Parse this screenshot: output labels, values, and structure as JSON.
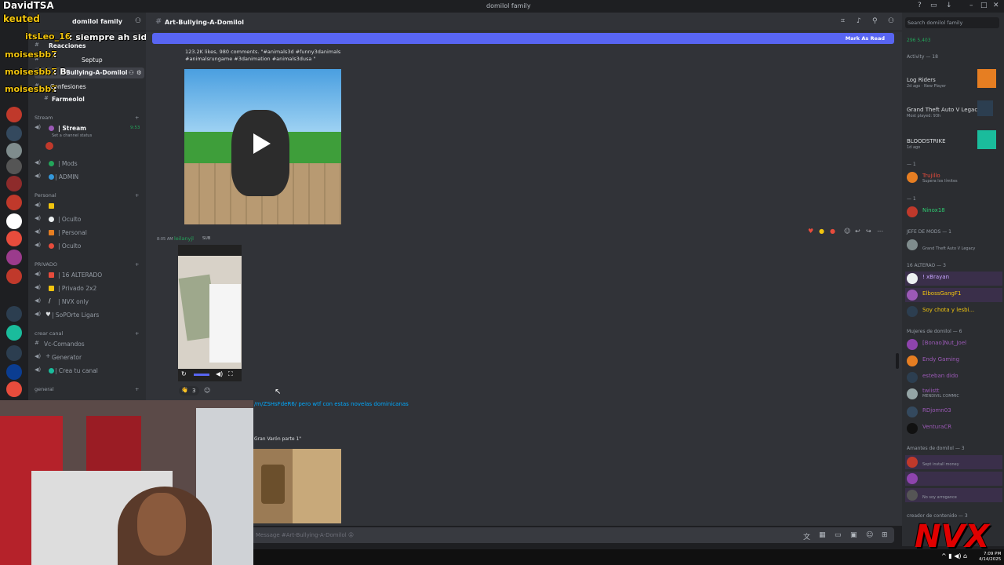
{
  "window": {
    "title": "domilol family",
    "icons": [
      "minimize-icon",
      "maximize-icon",
      "close-icon"
    ]
  },
  "server": {
    "name": "domilol family"
  },
  "overlay": {
    "streamer_tag": "DavidTSA",
    "lines": [
      {
        "user": "keuted",
        "text": ""
      },
      {
        "user": "itsLeo_16",
        "text": ": siempre ah sido w pero una de sus"
      },
      {
        "user": "moisesbb7",
        "text": ":"
      },
      {
        "user": "moisesbb7",
        "text": ": B"
      },
      {
        "user": "moisesbb7",
        "text": ":"
      }
    ]
  },
  "channels": {
    "top": [
      {
        "icon": "#",
        "label": "Reacciones"
      },
      {
        "icon": "#",
        "label": "Septup"
      },
      {
        "icon": "#",
        "label": "Bullying-A-Domilol"
      },
      {
        "icon": "#",
        "label": "Confesiones"
      },
      {
        "icon": "#",
        "label": "Farmeolol"
      }
    ],
    "categories": [
      {
        "label": "Stream",
        "items": [
          {
            "label": "| Stream",
            "sub": "Set a channel status",
            "count": "9:53"
          },
          {
            "label": "| Mods"
          },
          {
            "label": "| ADMIN"
          }
        ]
      },
      {
        "label": "Personal",
        "items": [
          {
            "label": ""
          },
          {
            "label": "| Oculto"
          },
          {
            "label": "| Personal"
          },
          {
            "label": "| Oculto"
          }
        ]
      },
      {
        "label": "PRIVADO",
        "items": [
          {
            "label": "| 16 ALTERADO"
          },
          {
            "label": "| Privado 2x2"
          },
          {
            "label": "| NVX only"
          },
          {
            "label": "| SoPOrte Ligars"
          }
        ]
      },
      {
        "label": "crear canal",
        "items": [
          {
            "label": "Vc-Comandos"
          },
          {
            "label": "Generator"
          },
          {
            "label": "| Crea tu canal"
          }
        ]
      },
      {
        "label": "general",
        "items": []
      }
    ]
  },
  "header": {
    "channel": "Art-Bullying-A-Domilol",
    "new_messages": "Mark As Read",
    "icons": [
      "threads-icon",
      "bell-icon",
      "pin-icon",
      "members-icon"
    ]
  },
  "messages": {
    "video1": {
      "caption": "123.2K likes, 980 comments. \"#animals3d #funny3danimals #animalsrungame #3danimation #animals3dusa \""
    },
    "msg2": {
      "time": "8:05 AM",
      "user": "leilanyjl",
      "tag": "SUB"
    },
    "reaction": {
      "emoji": "👋",
      "count": "3"
    },
    "link_text": "/m/ZSHsFdeR6/ pero wtf con estas novelas dominicanas",
    "embed_title": "Gran Varón parte 1\""
  },
  "composer": {
    "placeholder": "Message #Art-Bullying-A-Domilol 😝"
  },
  "members": {
    "search": "Search domilol family",
    "server_stats": "296  5,403",
    "activity_title": "Activity — 18",
    "activities": [
      {
        "name": "Log Riders",
        "sub": "2d ago · New Player",
        "color": "#e74c3c"
      },
      {
        "name": "Grand Theft Auto V Legacy",
        "sub": "Most played: 93h",
        "color": "#5865f2"
      },
      {
        "name": "BLOODSTRIKE",
        "sub": "1d ago",
        "color": "#e74c3c"
      }
    ],
    "sections": [
      {
        "title": "— 1",
        "users": [
          {
            "name": "Trujillo",
            "status": "Supera los límites",
            "color": "#e74c3c"
          }
        ]
      },
      {
        "title": "— 1",
        "users": [
          {
            "name": "Ninox18",
            "status": "",
            "color": "#2ecc71"
          }
        ]
      },
      {
        "title": "JEFE DE MODS — 1",
        "users": [
          {
            "name": "",
            "status": "Grand Theft Auto V Legacy",
            "color": "#2ecc71"
          }
        ]
      },
      {
        "title": "16 ALTERAO — 3",
        "users": [
          {
            "name": "! xBrayan",
            "status": "",
            "color": "#c8a6ff"
          },
          {
            "name": "ElbossGangF1",
            "status": "",
            "color": "#f1c40f"
          },
          {
            "name": "Soy chota y lesbi...",
            "status": "",
            "color": "#f1c40f"
          }
        ]
      },
      {
        "title": "Mujeres de domilol — 6",
        "users": [
          {
            "name": "[Bonao]Nut_Joel",
            "status": "",
            "color": "#9b59b6"
          },
          {
            "name": "Endy Gaming",
            "status": "",
            "color": "#9b59b6"
          },
          {
            "name": "esteban dido",
            "status": "",
            "color": "#9b59b6"
          },
          {
            "name": "twiistt",
            "status": "MENDIVIL COMMIC",
            "color": "#9b59b6"
          },
          {
            "name": "RDjomn03",
            "status": "",
            "color": "#9b59b6"
          },
          {
            "name": "VenturaCR",
            "status": "",
            "color": "#9b59b6"
          }
        ]
      },
      {
        "title": "Amantes de domilol — 3",
        "users": [
          {
            "name": "",
            "status": "Sept install money",
            "color": "#e74c3c"
          },
          {
            "name": "",
            "status": "",
            "color": "#e74c3c"
          },
          {
            "name": "",
            "status": "No soy arrogance",
            "color": "#e74c3c"
          }
        ]
      },
      {
        "title": "creador de contenido — 3",
        "users": []
      }
    ]
  },
  "taskbar": {
    "time": "7:09 PM",
    "date": "4/14/2025"
  },
  "brand": {
    "logo": "NVX",
    "accent": "#5865f2"
  }
}
